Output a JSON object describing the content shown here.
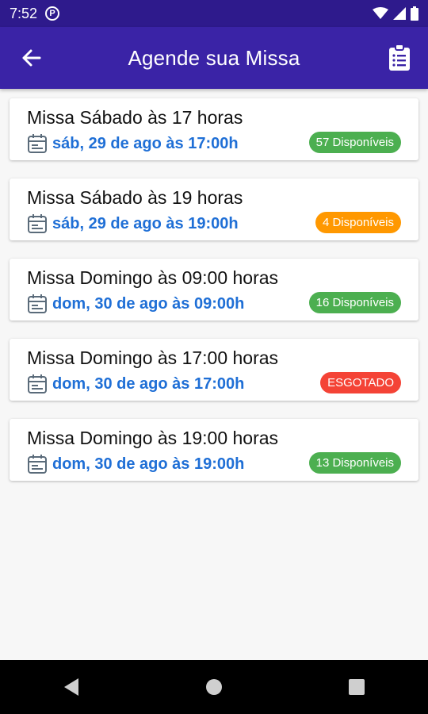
{
  "status_bar": {
    "time": "7:52",
    "app_icon_letter": "P"
  },
  "header": {
    "title": "Agende sua Missa"
  },
  "colors": {
    "available": "#4caf50",
    "low": "#ff9800",
    "sold_out": "#f44336",
    "date_text": "#1f6fd6",
    "app_bar": "#3a23a6"
  },
  "masses": [
    {
      "title": "Missa Sábado às 17 horas",
      "date": "sáb, 29 de ago às 17:00h",
      "badge": "57 Disponíveis",
      "badge_color": "#4caf50"
    },
    {
      "title": "Missa Sábado às 19 horas",
      "date": "sáb, 29 de ago às 19:00h",
      "badge": "4 Disponíveis",
      "badge_color": "#ff9800"
    },
    {
      "title": "Missa Domingo às 09:00 horas",
      "date": "dom, 30 de ago às 09:00h",
      "badge": "16 Disponíveis",
      "badge_color": "#4caf50"
    },
    {
      "title": "Missa Domingo às 17:00 horas",
      "date": "dom, 30 de ago às 17:00h",
      "badge": "ESGOTADO",
      "badge_color": "#f44336"
    },
    {
      "title": "Missa Domingo às 19:00 horas",
      "date": "dom, 30 de ago às 19:00h",
      "badge": "13 Disponíveis",
      "badge_color": "#4caf50"
    }
  ]
}
